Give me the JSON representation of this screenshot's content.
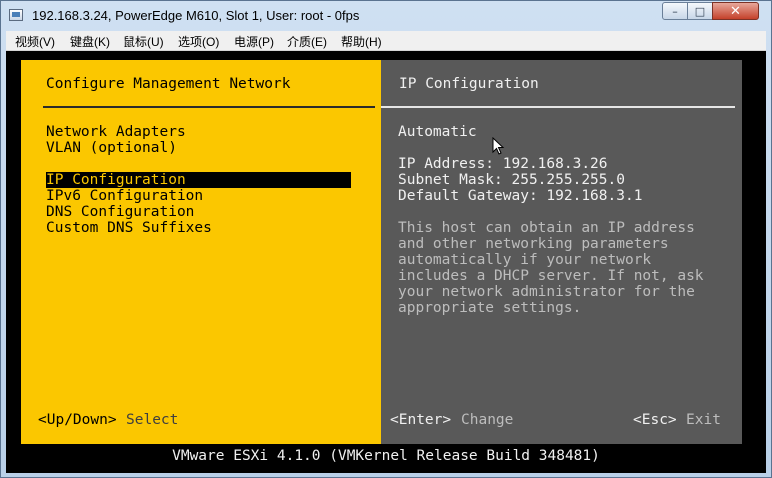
{
  "window": {
    "title": "192.168.3.24, PowerEdge M610, Slot 1, User: root - 0fps",
    "minimize_label": "–",
    "maximize_label": "□",
    "close_label": "✕"
  },
  "menubar": {
    "items": [
      "视频(V)",
      "键盘(K)",
      "鼠标(U)",
      "选项(O)",
      "电源(P)",
      "介质(E)",
      "帮助(H)"
    ]
  },
  "left": {
    "title": "Configure Management Network",
    "items": [
      "Network Adapters",
      "VLAN (optional)",
      "IP Configuration",
      "IPv6 Configuration",
      "DNS Configuration",
      "Custom DNS Suffixes"
    ],
    "selected_index": 2,
    "hint_key": "<Up/Down>",
    "hint_action": "Select"
  },
  "right": {
    "title": "IP Configuration",
    "mode": "Automatic",
    "ip_address": "IP Address: 192.168.3.26",
    "subnet_mask": "Subnet Mask: 255.255.255.0",
    "gateway": "Default Gateway: 192.168.3.1",
    "description": [
      "This host can obtain an IP address",
      "and other networking parameters",
      "automatically if your network",
      "includes a DHCP server. If not, ask",
      "your network administrator for the",
      "appropriate settings."
    ],
    "enter_key": "<Enter>",
    "enter_action": "Change",
    "esc_key": "<Esc>",
    "esc_action": "Exit"
  },
  "footer": {
    "text": "VMware ESXi 4.1.0 (VMKernel Release Build 348481)"
  },
  "colors": {
    "panel_yellow": "#fbc700",
    "panel_gray": "#595959",
    "console_bg": "#000000"
  },
  "icons": {
    "app": "console-window-icon",
    "cursor": "mouse-pointer-icon"
  }
}
